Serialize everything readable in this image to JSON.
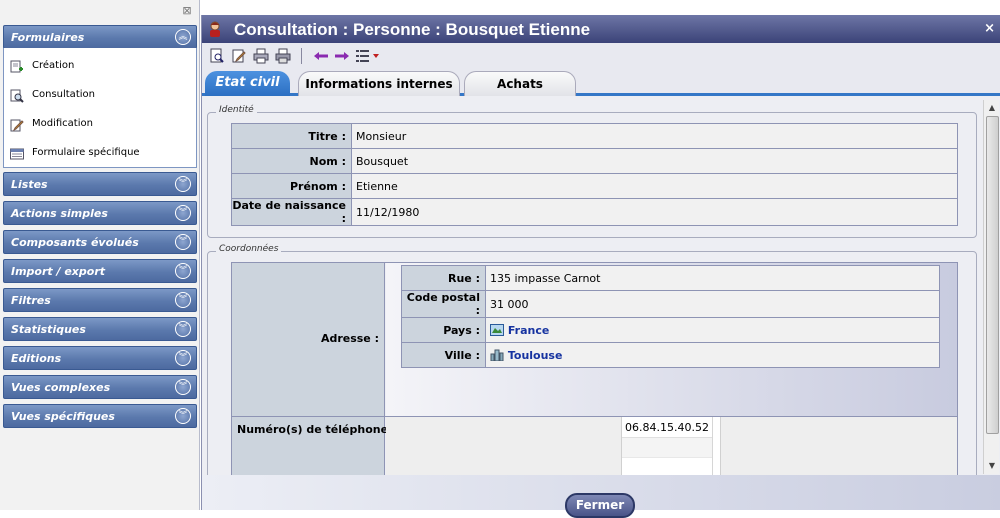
{
  "sidebar": {
    "sections": [
      {
        "label": "Formulaires",
        "expanded": true,
        "items": [
          {
            "label": "Création",
            "icon": "create-form-icon"
          },
          {
            "label": "Consultation",
            "icon": "consult-form-icon"
          },
          {
            "label": "Modification",
            "icon": "edit-form-icon"
          },
          {
            "label": "Formulaire spécifique",
            "icon": "specific-form-icon"
          }
        ]
      },
      {
        "label": "Listes"
      },
      {
        "label": "Actions simples"
      },
      {
        "label": "Composants évolués"
      },
      {
        "label": "Import / export"
      },
      {
        "label": "Filtres"
      },
      {
        "label": "Statistiques"
      },
      {
        "label": "Editions"
      },
      {
        "label": "Vues complexes"
      },
      {
        "label": "Vues spécifiques"
      }
    ]
  },
  "window": {
    "title": "Consultation : Personne : Bousquet Etienne",
    "close_glyph": "×"
  },
  "tabs": [
    {
      "label": "Etat civil",
      "active": true
    },
    {
      "label": "Informations internes",
      "active": false
    },
    {
      "label": "Achats",
      "active": false
    }
  ],
  "identite": {
    "group_title": "Identité",
    "fields": [
      {
        "label": "Titre :",
        "value": "Monsieur"
      },
      {
        "label": "Nom :",
        "value": "Bousquet"
      },
      {
        "label": "Prénom :",
        "value": "Etienne"
      },
      {
        "label": "Date de naissance :",
        "value": "11/12/1980"
      }
    ]
  },
  "coordonnees": {
    "group_title": "Coordonnées",
    "adresse_label": "Adresse :",
    "adresse": [
      {
        "label": "Rue :",
        "value": "135 impasse Carnot",
        "link": false
      },
      {
        "label": "Code postal :",
        "value": "31 000",
        "link": false
      },
      {
        "label": "Pays :",
        "value": "France",
        "link": true,
        "icon": "country-icon"
      },
      {
        "label": "Ville :",
        "value": "Toulouse",
        "link": true,
        "icon": "city-icon"
      }
    ],
    "phone_label": "Numéro(s) de téléphone :",
    "phones": [
      "06.84.15.40.52"
    ]
  },
  "footer": {
    "close_label": "Fermer"
  },
  "colors": {
    "accent": "#3477c7",
    "sidebar_header": "#5b79ad",
    "title_bar": "#3b4378",
    "link": "#1633a0"
  }
}
